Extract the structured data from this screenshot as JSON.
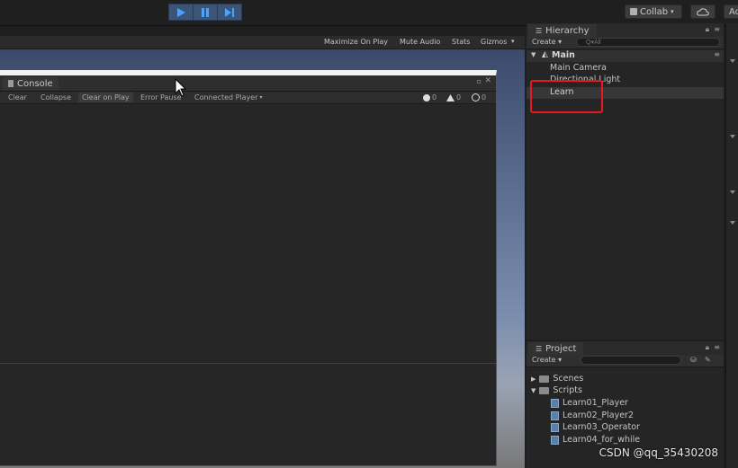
{
  "toolbar": {
    "play_icon": "play-icon",
    "pause_icon": "pause-icon",
    "step_icon": "step-icon",
    "collab_label": "Collab",
    "account_label": "Ac",
    "play_color": "#3a5578"
  },
  "game": {
    "maximize_on_play": "Maximize On Play",
    "mute_audio": "Mute Audio",
    "stats": "Stats",
    "gizmos": "Gizmos"
  },
  "console": {
    "title": "Console",
    "buttons": [
      "Clear",
      "Collapse",
      "Clear on Play",
      "Error Pause",
      "Connected Player"
    ],
    "error_count": "0",
    "warning_count": "0",
    "info_count": "0"
  },
  "hierarchy": {
    "title": "Hierarchy",
    "create_label": "Create",
    "search_placeholder": "Q▾All",
    "scene_name": "Main",
    "items": [
      "Main Camera",
      "Directional Light",
      "Learn"
    ]
  },
  "project": {
    "title": "Project",
    "create_label": "Create",
    "folders": [
      "Scenes",
      "Scripts"
    ],
    "scripts": [
      "Learn01_Player",
      "Learn02_Player2",
      "Learn03_Operator",
      "Learn04_for_while"
    ]
  },
  "watermark": "CSDN @qq_35430208",
  "highlight_color": "#e5191f"
}
